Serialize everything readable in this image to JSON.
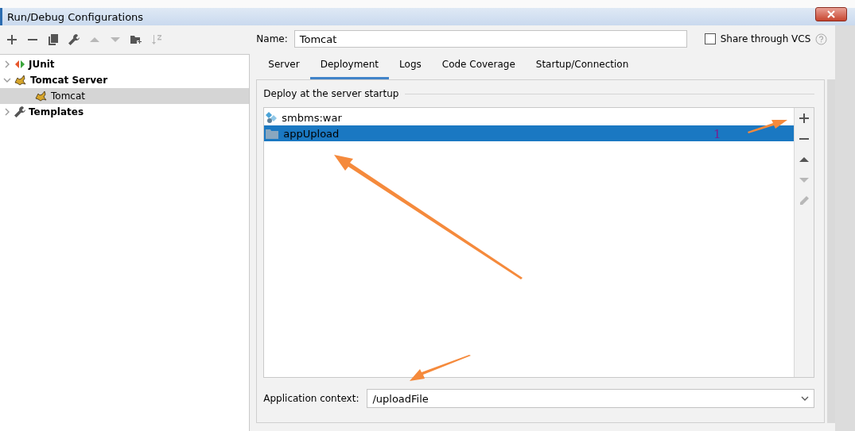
{
  "window": {
    "title": "Run/Debug Configurations"
  },
  "toolbar": [
    {
      "kind": "add",
      "disabled": false
    },
    {
      "kind": "remove",
      "disabled": false
    },
    {
      "kind": "copy",
      "disabled": false
    },
    {
      "kind": "wrench",
      "disabled": false
    },
    {
      "kind": "up",
      "disabled": true
    },
    {
      "kind": "down",
      "disabled": true
    },
    {
      "kind": "folder",
      "disabled": false
    },
    {
      "kind": "sort",
      "disabled": true
    }
  ],
  "tree": [
    {
      "label": "JUnit",
      "kind": "junit",
      "expanded": false,
      "selected": false
    },
    {
      "label": "Tomcat Server",
      "kind": "tomcat",
      "expanded": true,
      "selected": false,
      "children": [
        {
          "label": "Tomcat",
          "kind": "tomcat",
          "selected": true
        }
      ]
    },
    {
      "label": "Templates",
      "kind": "wrench",
      "expanded": false,
      "selected": false
    }
  ],
  "name_field": {
    "label": "Name:",
    "value": "Tomcat"
  },
  "share": {
    "label": "Share through VCS",
    "checked": false
  },
  "tabs": [
    {
      "label": "Server",
      "selected": false
    },
    {
      "label": "Deployment",
      "selected": true
    },
    {
      "label": "Logs",
      "selected": false
    },
    {
      "label": "Code Coverage",
      "selected": false
    },
    {
      "label": "Startup/Connection",
      "selected": false
    }
  ],
  "deploy": {
    "title": "Deploy at the server startup",
    "items": [
      {
        "label": "smbms:war",
        "kind": "artifact",
        "selected": false
      },
      {
        "label": "appUpload",
        "kind": "folder",
        "selected": true
      }
    ],
    "side_buttons": [
      {
        "kind": "add",
        "disabled": false
      },
      {
        "kind": "remove",
        "disabled": false
      },
      {
        "kind": "up",
        "disabled": false
      },
      {
        "kind": "down",
        "disabled": true
      },
      {
        "kind": "edit",
        "disabled": true
      }
    ]
  },
  "app_context": {
    "label": "Application context:",
    "value": "/uploadFile"
  },
  "annotation": {
    "label": "1"
  }
}
